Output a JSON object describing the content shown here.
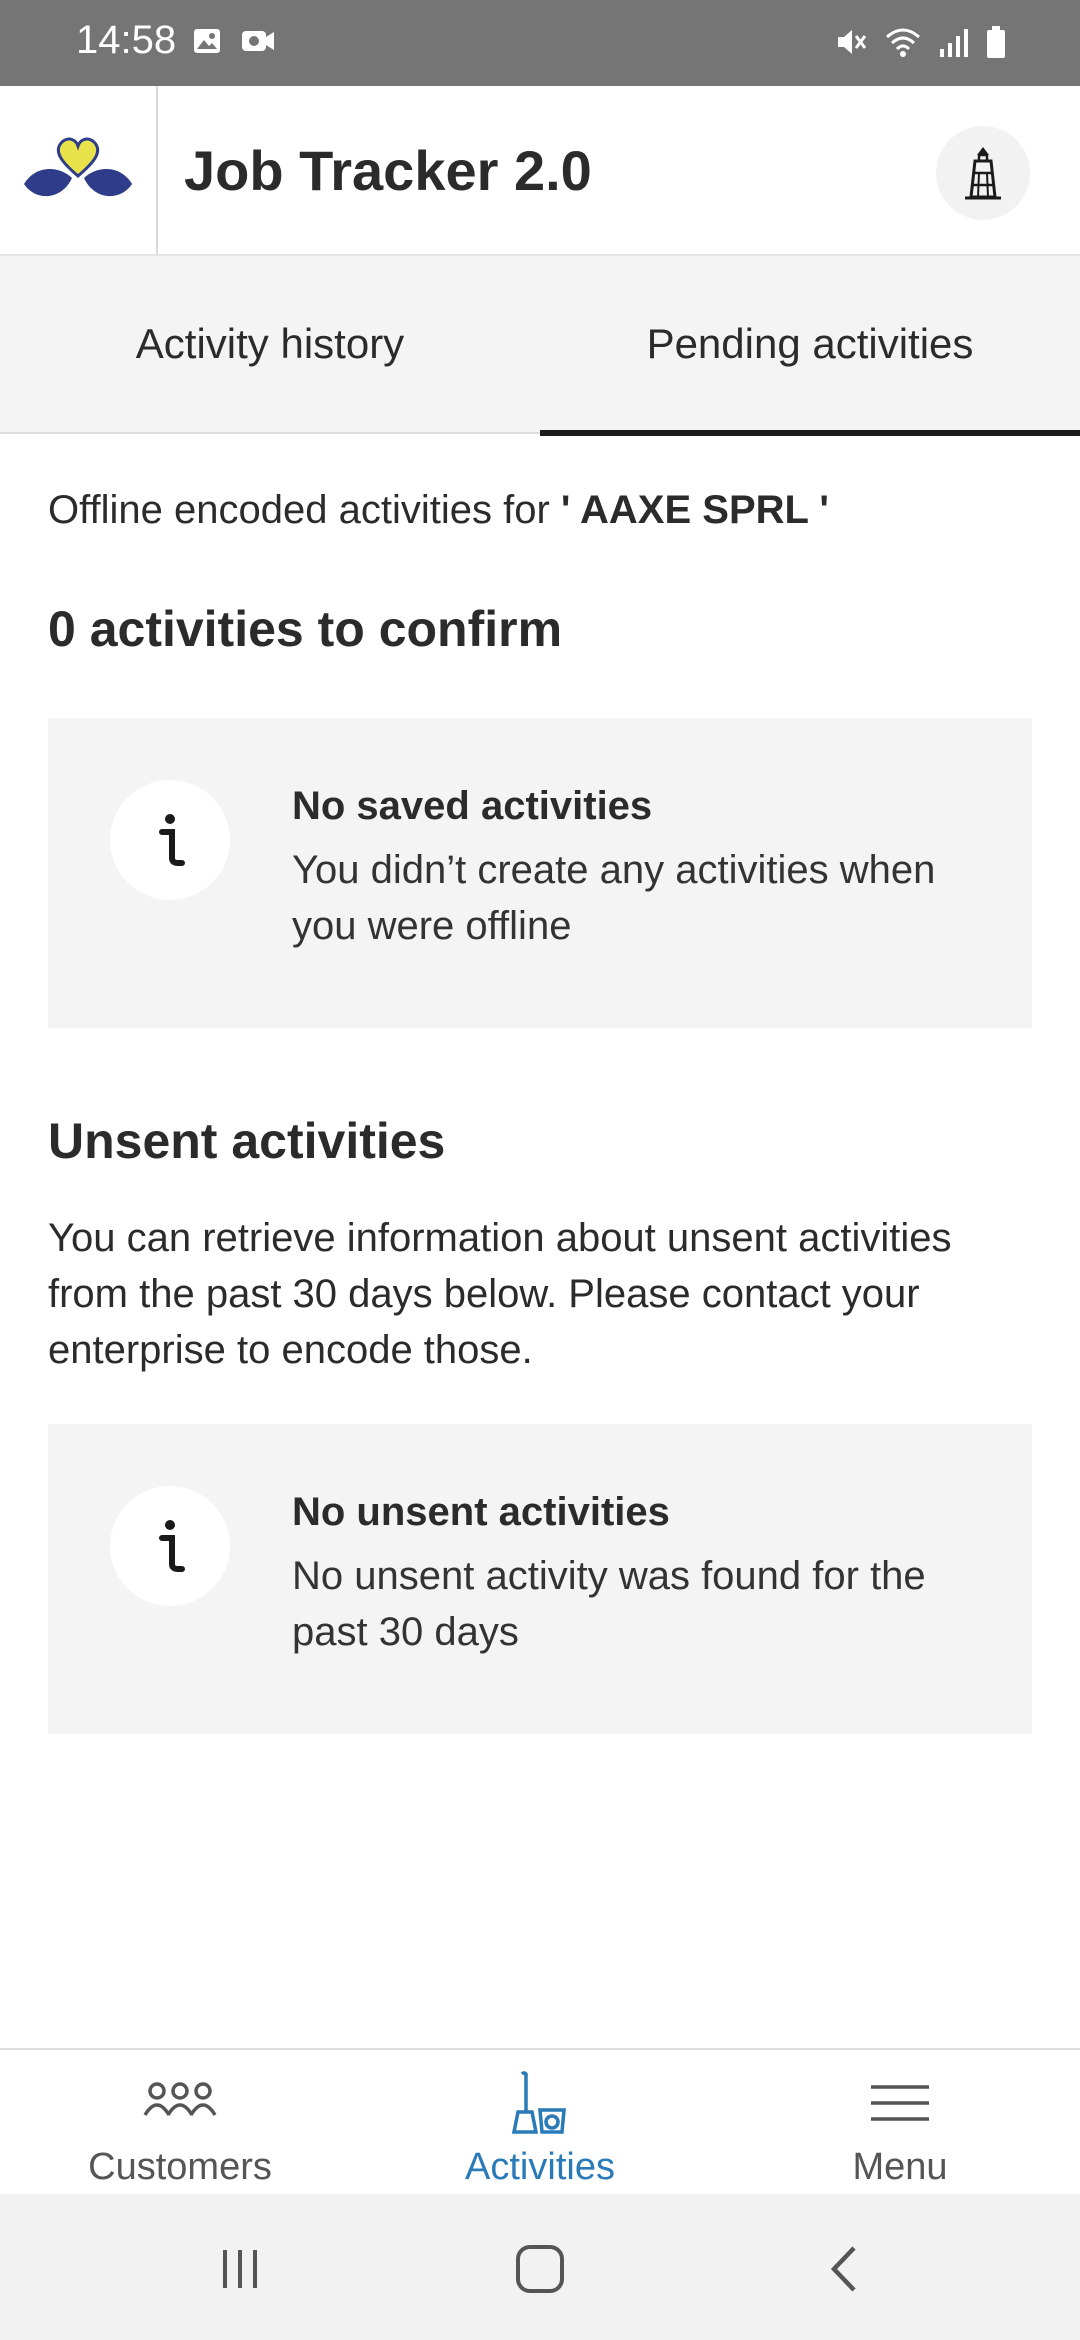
{
  "status_bar": {
    "time": "14:58",
    "left_icons": [
      "image-icon",
      "video-icon"
    ],
    "right_icons": [
      "mute-icon",
      "wifi-icon",
      "signal-icon",
      "battery-icon"
    ]
  },
  "app_bar": {
    "title": "Job Tracker 2.0",
    "logo_icon": "heart-leaves-logo",
    "action_icon": "lighthouse-icon"
  },
  "tabs": [
    {
      "label": "Activity history",
      "active": false
    },
    {
      "label": "Pending activities",
      "active": true
    }
  ],
  "main": {
    "offline_prefix": "Offline encoded activities for",
    "offline_company": "' AAXE SPRL '",
    "confirm_heading": "0 activities to confirm",
    "saved_card": {
      "icon": "info-icon",
      "title": "No saved activities",
      "text": "You didn’t create any activities when you were offline"
    },
    "unsent_heading": "Unsent activities",
    "unsent_description": "You can retrieve information about unsent activities from the past 30 days below. Please contact your enterprise to encode those.",
    "unsent_card": {
      "icon": "info-icon",
      "title": "No unsent activities",
      "text": "No unsent activity was found for the past 30 days"
    }
  },
  "bottom_nav": [
    {
      "label": "Customers",
      "icon": "people-icon",
      "active": false
    },
    {
      "label": "Activities",
      "icon": "brush-bucket-icon",
      "active": true
    },
    {
      "label": "Menu",
      "icon": "hamburger-icon",
      "active": false
    }
  ],
  "colors": {
    "accent": "#2a7ab8",
    "status_bar": "#757575",
    "card_bg": "#f4f4f4",
    "logo_yellow": "#e8e34a",
    "logo_navy": "#2e3c8a"
  }
}
